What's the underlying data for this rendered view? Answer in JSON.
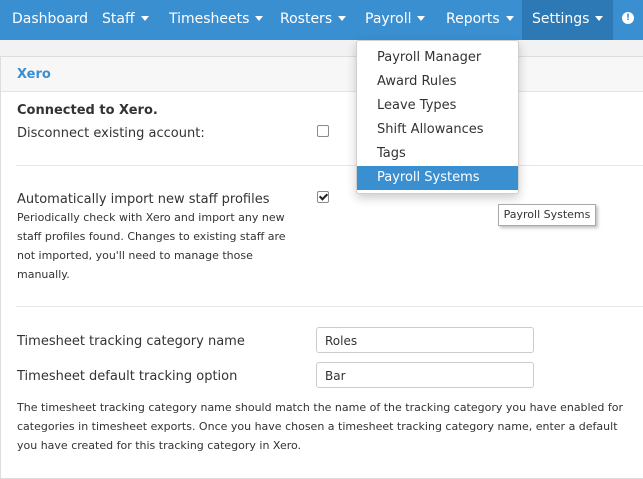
{
  "nav": {
    "items": [
      {
        "label": "Dashboard",
        "caret": false
      },
      {
        "label": "Staff",
        "caret": true
      },
      {
        "label": "Timesheets",
        "caret": true
      },
      {
        "label": "Rosters",
        "caret": true
      },
      {
        "label": "Payroll",
        "caret": true
      },
      {
        "label": "Reports",
        "caret": true
      },
      {
        "label": "Settings",
        "caret": true,
        "active": true
      }
    ],
    "alert_glyph": "!"
  },
  "panel": {
    "title": "Xero",
    "connected_label": "Connected to Xero.",
    "disconnect_label": "Disconnect existing account:",
    "disconnect_checked": false,
    "auto_import_label": "Automatically import new staff profiles",
    "auto_import_checked": true,
    "auto_import_help": [
      "Periodically check with Xero and import any new",
      "staff profiles found. Changes to existing staff are",
      "not imported, you'll need to manage those",
      "manually."
    ],
    "tracking_category_label": "Timesheet tracking category name",
    "tracking_category_value": "Roles",
    "default_option_label": "Timesheet default tracking option",
    "default_option_value": "Bar",
    "tracking_help": [
      "The timesheet tracking category name should match the name of the tracking category you have enabled for",
      "categories in timesheet exports. Once you have chosen a timesheet tracking category name, enter a default",
      "you have created for this tracking category in Xero."
    ]
  },
  "payroll_menu": {
    "items": [
      "Payroll Manager",
      "Award Rules",
      "Leave Types",
      "Shift Allowances",
      "Tags",
      "Payroll Systems"
    ],
    "highlighted_index": 5
  },
  "tooltip": "Payroll Systems",
  "colors": {
    "navbar": "#3a8fd0",
    "navbar_active": "#2d79b6",
    "highlight": "#3a8fd0"
  }
}
